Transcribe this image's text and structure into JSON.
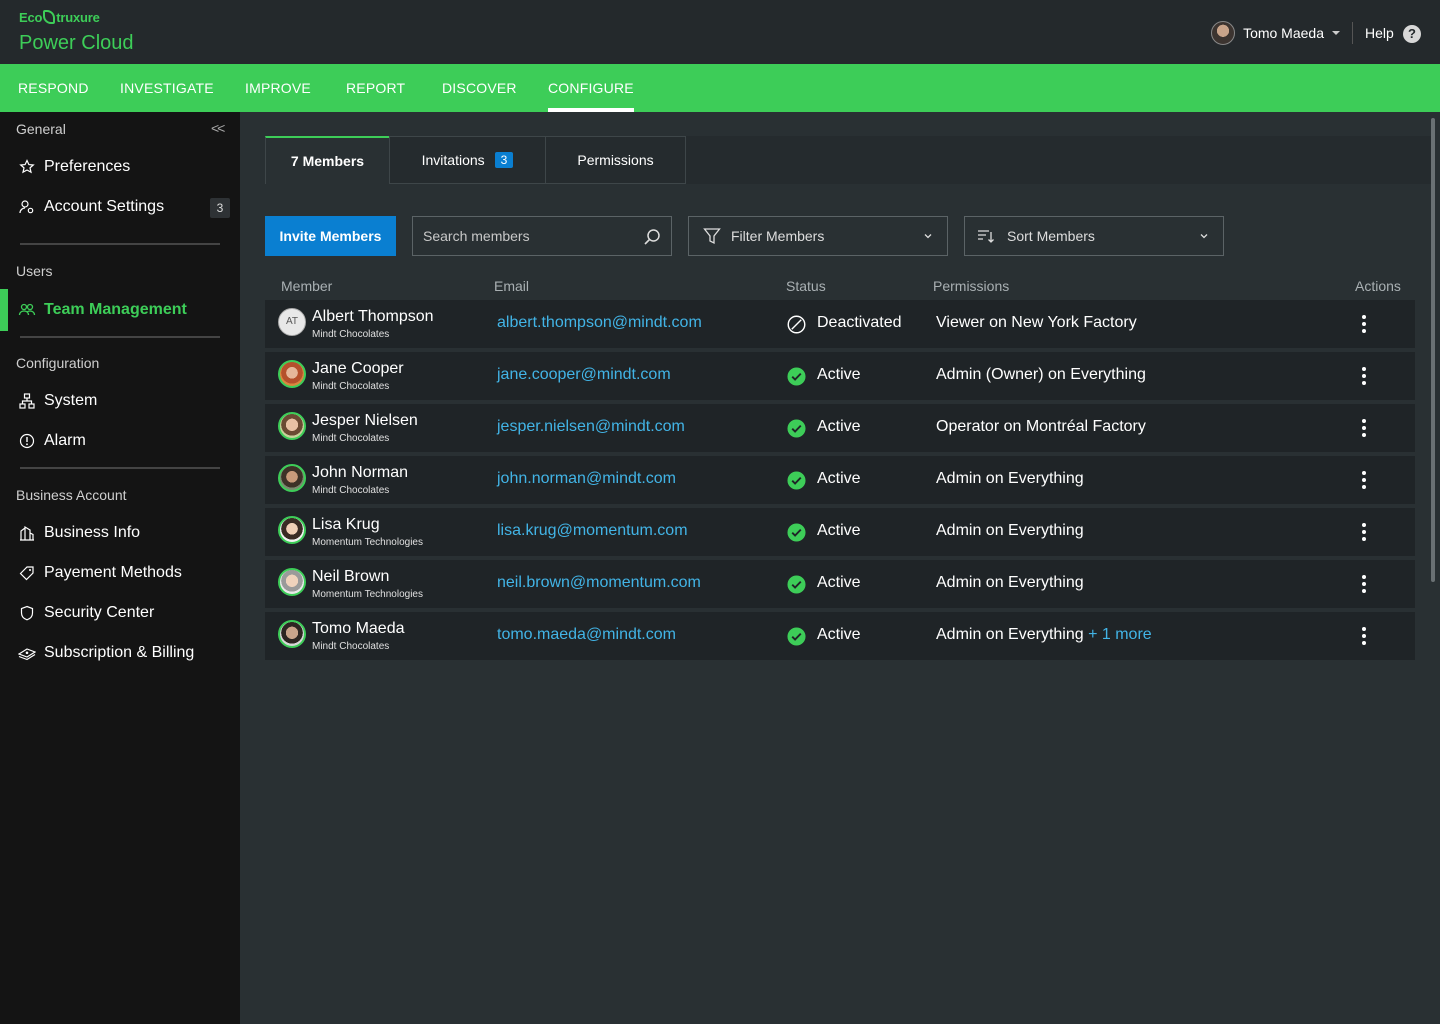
{
  "brand": {
    "small": "EcoStruxure",
    "small_a": "Eco",
    "small_b": "truxure",
    "product": "Power Cloud"
  },
  "user": {
    "name": "Tomo Maeda"
  },
  "help": {
    "label": "Help",
    "icon": "?"
  },
  "nav": {
    "items": [
      {
        "label": "RESPOND"
      },
      {
        "label": "INVESTIGATE"
      },
      {
        "label": "IMPROVE"
      },
      {
        "label": "REPORT"
      },
      {
        "label": "DISCOVER"
      },
      {
        "label": "CONFIGURE",
        "active": true
      }
    ]
  },
  "sidebar": {
    "collapse": "<<",
    "sections": {
      "general": "General",
      "users": "Users",
      "configuration": "Configuration",
      "business": "Business Account"
    },
    "items": {
      "preferences": "Preferences",
      "account_settings": "Account Settings",
      "account_settings_badge": "3",
      "team_management": "Team Management",
      "system": "System",
      "alarm": "Alarm",
      "business_info": "Business Info",
      "payment_methods": "Payement Methods",
      "security_center": "Security Center",
      "subscription_billing": "Subscription & Billing"
    }
  },
  "tabs": {
    "members": "7 Members",
    "invitations": "Invitations",
    "invitations_badge": "3",
    "permissions": "Permissions"
  },
  "controls": {
    "invite": "Invite Members",
    "search_placeholder": "Search members",
    "filter": "Filter Members",
    "sort": "Sort Members"
  },
  "table": {
    "headers": {
      "member": "Member",
      "email": "Email",
      "status": "Status",
      "permissions": "Permissions",
      "actions": "Actions"
    },
    "rows": [
      {
        "initials": "AT",
        "name": "Albert Thompson",
        "org": "Mindt Chocolates",
        "email": "albert.thompson@mindt.com",
        "status": "Deactivated",
        "permission": "Viewer on New York Factory",
        "more": ""
      },
      {
        "name": "Jane Cooper",
        "org": "Mindt Chocolates",
        "email": "jane.cooper@mindt.com",
        "status": "Active",
        "permission": "Admin (Owner) on Everything",
        "more": ""
      },
      {
        "name": "Jesper Nielsen",
        "org": "Mindt Chocolates",
        "email": "jesper.nielsen@mindt.com",
        "status": "Active",
        "permission": "Operator on Montréal Factory",
        "more": ""
      },
      {
        "name": "John Norman",
        "org": "Mindt Chocolates",
        "email": "john.norman@mindt.com",
        "status": "Active",
        "permission": "Admin on Everything",
        "more": ""
      },
      {
        "name": "Lisa Krug",
        "org": "Momentum Technologies",
        "email": "lisa.krug@momentum.com",
        "status": "Active",
        "permission": "Admin on Everything",
        "more": ""
      },
      {
        "name": "Neil Brown",
        "org": "Momentum Technologies",
        "email": "neil.brown@momentum.com",
        "status": "Active",
        "permission": "Admin on Everything",
        "more": ""
      },
      {
        "name": "Tomo Maeda",
        "org": "Mindt Chocolates",
        "email": "tomo.maeda@mindt.com",
        "status": "Active",
        "permission": "Admin on Everything",
        "more": "+ 1 more"
      }
    ]
  },
  "colors": {
    "accent": "#3dcd58",
    "link": "#42b4e6",
    "primary": "#0a7fd1",
    "bg": "#293033",
    "sidebar": "#141414"
  }
}
